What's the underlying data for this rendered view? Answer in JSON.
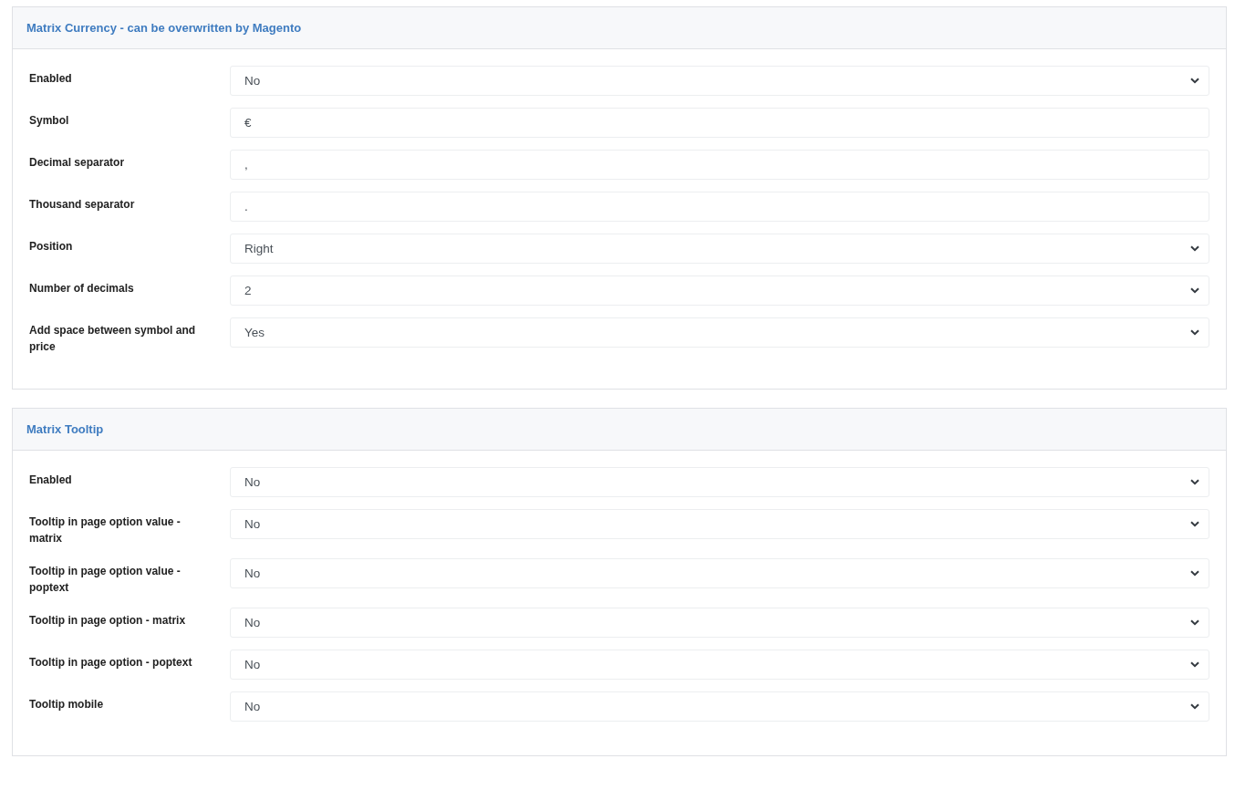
{
  "panels": [
    {
      "title": "Matrix Currency - can be overwritten by Magento",
      "fields": [
        {
          "label": "Enabled",
          "kind": "select",
          "value": "No"
        },
        {
          "label": "Symbol",
          "kind": "text",
          "value": "€"
        },
        {
          "label": "Decimal separator",
          "kind": "text",
          "value": ","
        },
        {
          "label": "Thousand separator",
          "kind": "text",
          "value": "."
        },
        {
          "label": "Position",
          "kind": "select",
          "value": "Right"
        },
        {
          "label": "Number of decimals",
          "kind": "select",
          "value": "2"
        },
        {
          "label": "Add space between symbol and price",
          "kind": "select",
          "value": "Yes"
        }
      ]
    },
    {
      "title": "Matrix Tooltip",
      "fields": [
        {
          "label": "Enabled",
          "kind": "select",
          "value": "No"
        },
        {
          "label": "Tooltip in page option value - matrix",
          "kind": "select",
          "value": "No"
        },
        {
          "label": "Tooltip in page option value - poptext",
          "kind": "select",
          "value": "No"
        },
        {
          "label": "Tooltip in page option - matrix",
          "kind": "select",
          "value": "No"
        },
        {
          "label": "Tooltip in page option - poptext",
          "kind": "select",
          "value": "No"
        },
        {
          "label": "Tooltip mobile",
          "kind": "select",
          "value": "No"
        }
      ]
    }
  ]
}
